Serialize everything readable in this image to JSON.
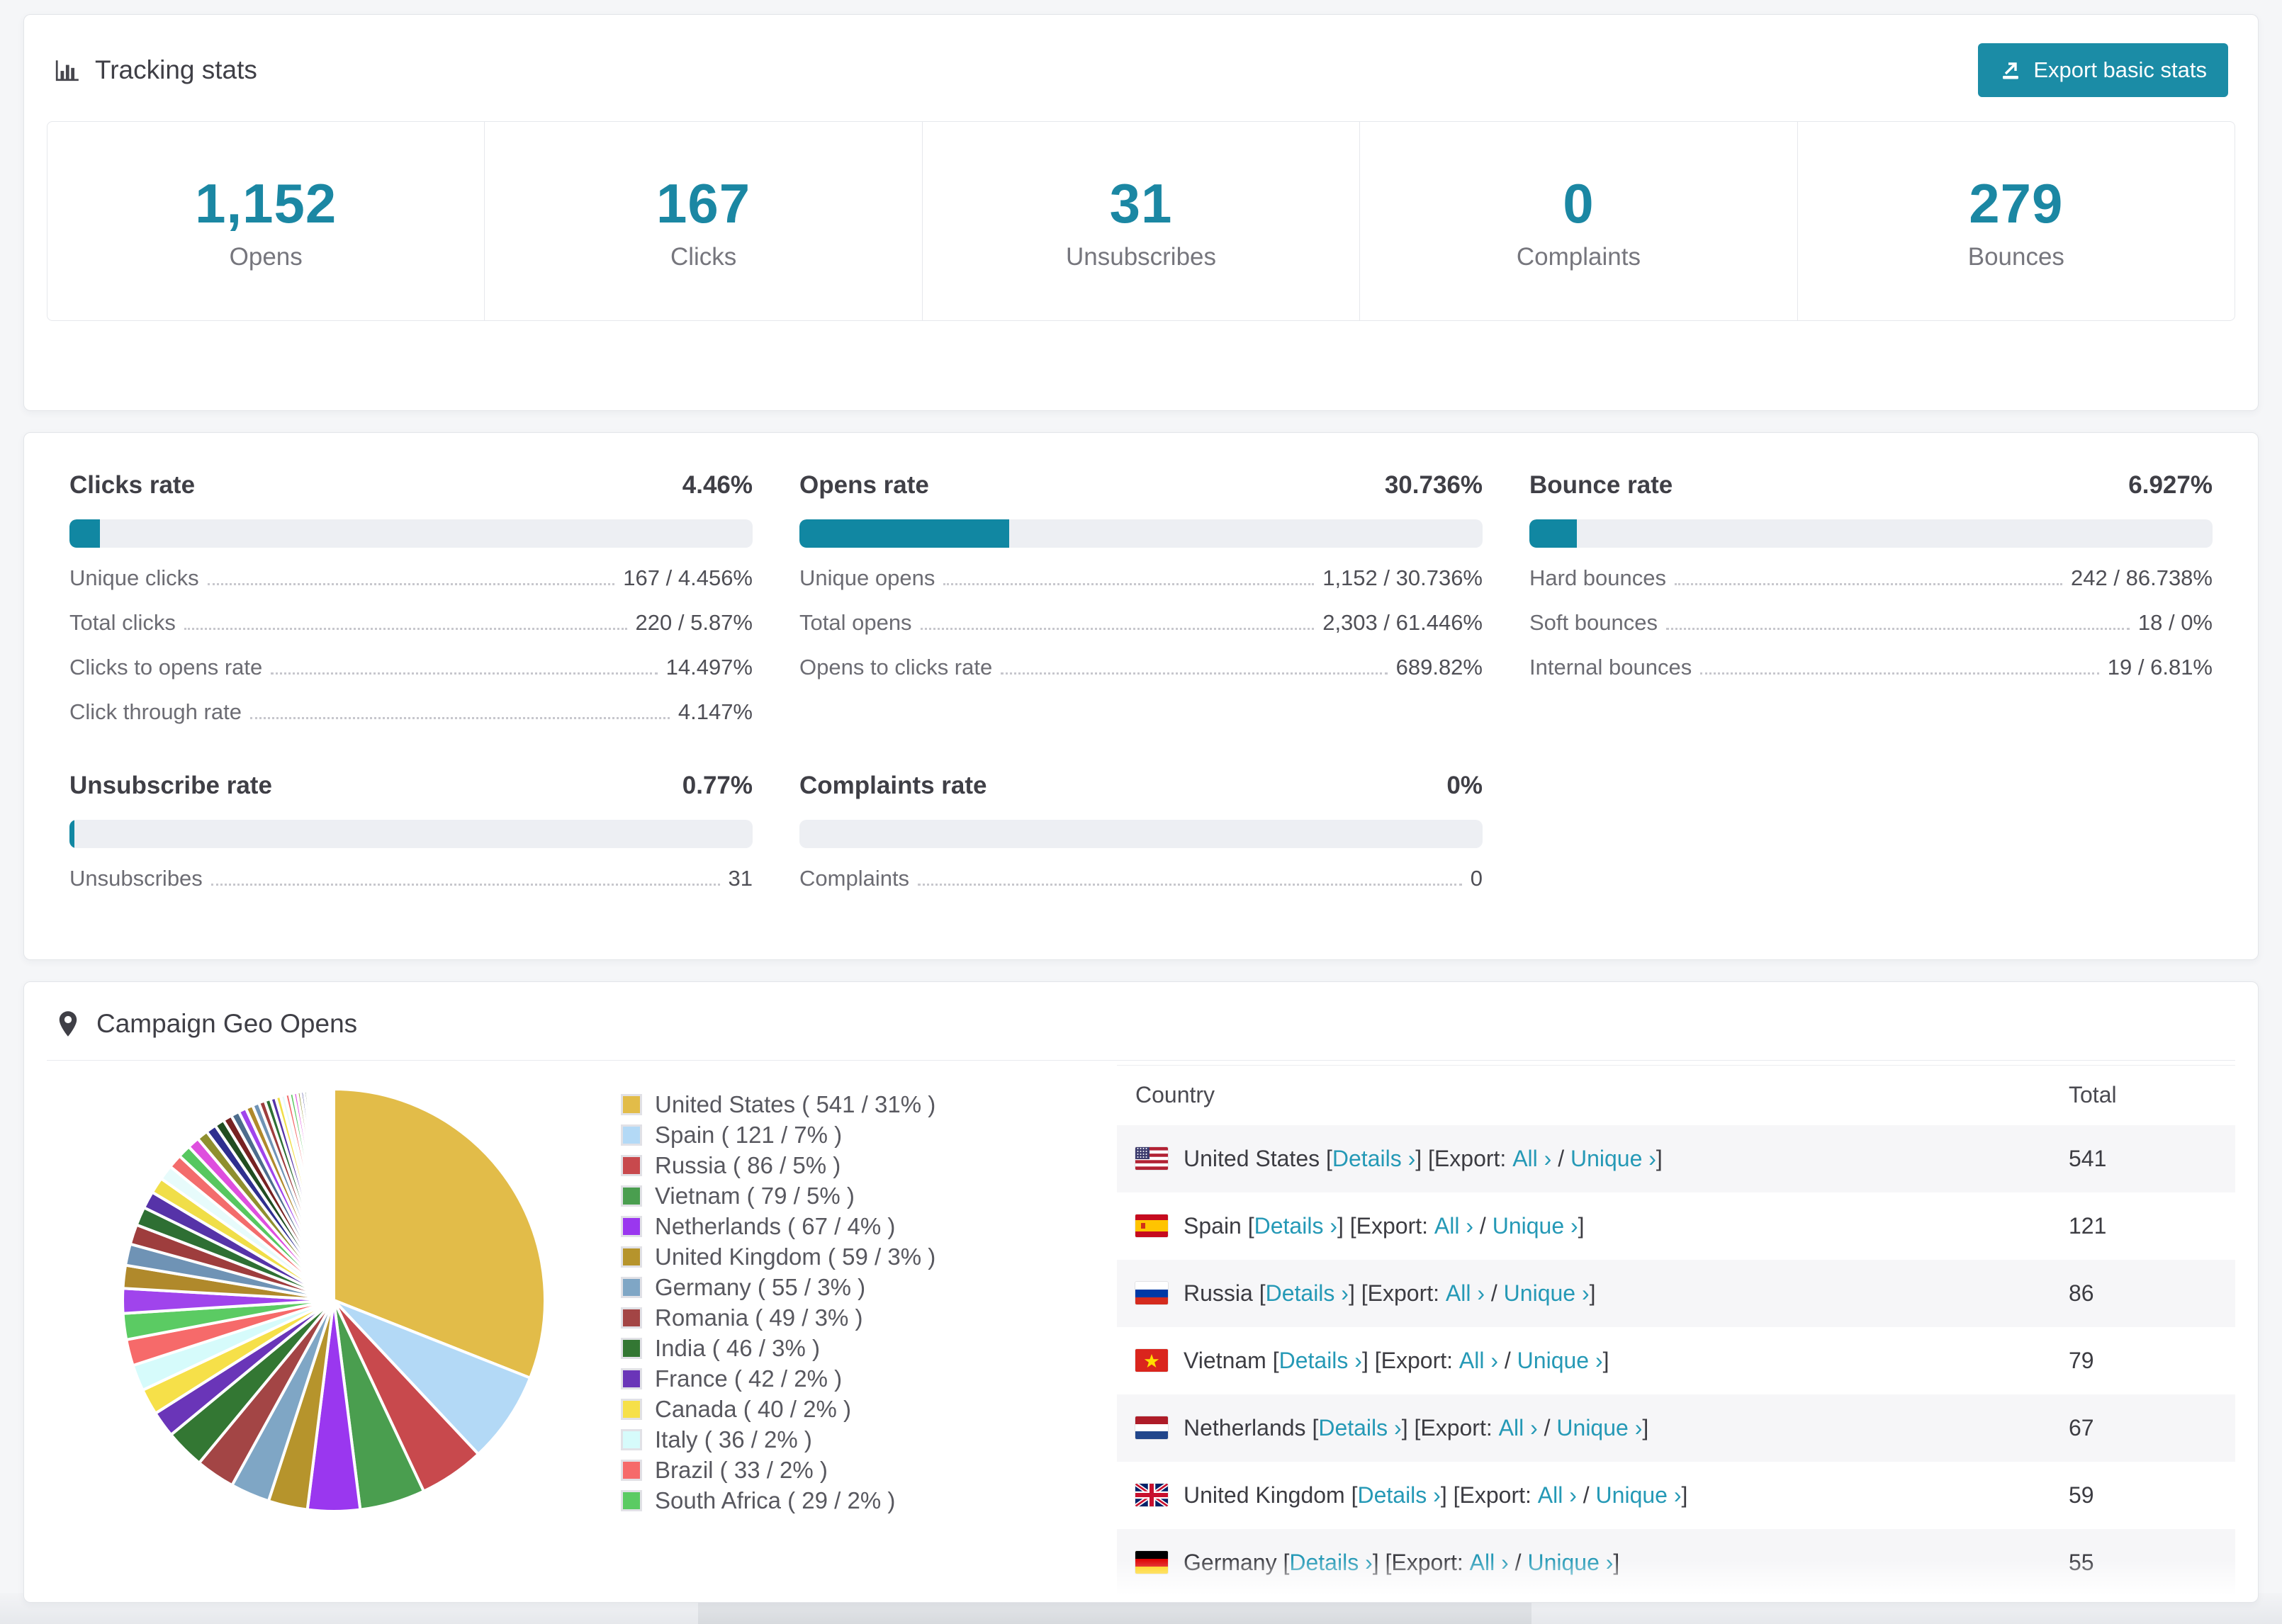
{
  "accent": "#1b87a3",
  "link_color": "#2599b6",
  "header": {
    "title": "Tracking stats",
    "export_button": "Export basic stats"
  },
  "summary_stats": [
    {
      "value": "1,152",
      "label": "Opens"
    },
    {
      "value": "167",
      "label": "Clicks"
    },
    {
      "value": "31",
      "label": "Unsubscribes"
    },
    {
      "value": "0",
      "label": "Complaints"
    },
    {
      "value": "279",
      "label": "Bounces"
    }
  ],
  "rate_panels": [
    {
      "title": "Clicks rate",
      "value": "4.46%",
      "percent": 4.46,
      "rows": [
        {
          "label": "Unique clicks",
          "value": "167 / 4.456%"
        },
        {
          "label": "Total clicks",
          "value": "220 / 5.87%"
        },
        {
          "label": "Clicks to opens rate",
          "value": "14.497%"
        },
        {
          "label": "Click through rate",
          "value": "4.147%"
        }
      ]
    },
    {
      "title": "Opens rate",
      "value": "30.736%",
      "percent": 30.736,
      "rows": [
        {
          "label": "Unique opens",
          "value": "1,152 / 30.736%"
        },
        {
          "label": "Total opens",
          "value": "2,303 / 61.446%"
        },
        {
          "label": "Opens to clicks rate",
          "value": "689.82%"
        }
      ]
    },
    {
      "title": "Bounce rate",
      "value": "6.927%",
      "percent": 6.927,
      "rows": [
        {
          "label": "Hard bounces",
          "value": "242 / 86.738%"
        },
        {
          "label": "Soft bounces",
          "value": "18 / 0%"
        },
        {
          "label": "Internal bounces",
          "value": "19 / 6.81%"
        }
      ]
    },
    {
      "title": "Unsubscribe rate",
      "value": "0.77%",
      "percent": 0.77,
      "rows": [
        {
          "label": "Unsubscribes",
          "value": "31"
        }
      ]
    },
    {
      "title": "Complaints rate",
      "value": "0%",
      "percent": 0,
      "rows": [
        {
          "label": "Complaints",
          "value": "0"
        }
      ]
    }
  ],
  "geo": {
    "title": "Campaign Geo Opens",
    "table": {
      "columns": [
        "Country",
        "Total"
      ],
      "details_label": "Details ›",
      "export_prefix": "Export:",
      "all_label": "All ›",
      "unique_label": "Unique ›",
      "rows": [
        {
          "country": "United States",
          "flag": "us",
          "total": "541"
        },
        {
          "country": "Spain",
          "flag": "es",
          "total": "121"
        },
        {
          "country": "Russia",
          "flag": "ru",
          "total": "86"
        },
        {
          "country": "Vietnam",
          "flag": "vn",
          "total": "79"
        },
        {
          "country": "Netherlands",
          "flag": "nl",
          "total": "67"
        },
        {
          "country": "United Kingdom",
          "flag": "gb",
          "total": "59"
        },
        {
          "country": "Germany",
          "flag": "de",
          "total": "55"
        }
      ]
    }
  },
  "chart_data": {
    "type": "pie",
    "title": "Campaign Geo Opens",
    "legend_position": "right",
    "start_angle_deg": 0,
    "direction": "clockwise",
    "slices": [
      {
        "label": "United States",
        "count": 541,
        "percent": 31,
        "color": "#e2bc49"
      },
      {
        "label": "Spain",
        "count": 121,
        "percent": 7,
        "color": "#b3d9f6"
      },
      {
        "label": "Russia",
        "count": 86,
        "percent": 5,
        "color": "#c8494d"
      },
      {
        "label": "Vietnam",
        "count": 79,
        "percent": 5,
        "color": "#4a9e4f"
      },
      {
        "label": "Netherlands",
        "count": 67,
        "percent": 4,
        "color": "#9a37ef"
      },
      {
        "label": "United Kingdom",
        "count": 59,
        "percent": 3,
        "color": "#b6942c"
      },
      {
        "label": "Germany",
        "count": 55,
        "percent": 3,
        "color": "#7fa6c5"
      },
      {
        "label": "Romania",
        "count": 49,
        "percent": 3,
        "color": "#a34545"
      },
      {
        "label": "India",
        "count": 46,
        "percent": 3,
        "color": "#337733"
      },
      {
        "label": "France",
        "count": 42,
        "percent": 2,
        "color": "#6a35b8"
      },
      {
        "label": "Canada",
        "count": 40,
        "percent": 2,
        "color": "#f6e049"
      },
      {
        "label": "Italy",
        "count": 36,
        "percent": 2,
        "color": "#d6fbfb"
      },
      {
        "label": "Brazil",
        "count": 33,
        "percent": 2,
        "color": "#f66a6a"
      },
      {
        "label": "South Africa",
        "count": 29,
        "percent": 2,
        "color": "#5bcb63"
      }
    ],
    "other_slices": {
      "note": "long tail of small unlabeled countries",
      "count": 45,
      "total_percent": 26,
      "palette": [
        "#a044ec",
        "#b0892b",
        "#6f93b5",
        "#9e3d3d",
        "#2e6f33",
        "#5633a8",
        "#f0de48",
        "#e7fbfb",
        "#f36c6c",
        "#57c75f",
        "#de4fde",
        "#8f8f2e",
        "#2f2f8f",
        "#214d21",
        "#772222",
        "#4d6d8d"
      ]
    }
  }
}
